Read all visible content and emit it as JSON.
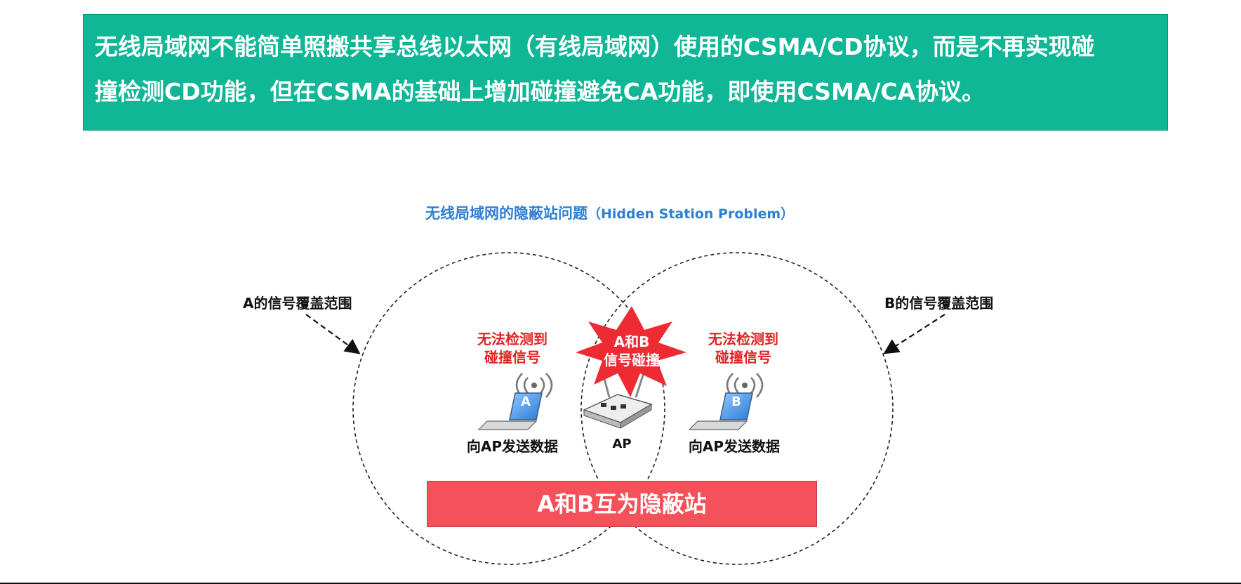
{
  "banner": {
    "line1": "无线局域网不能简单照搬共享总线以太网（有线局域网）使用的CSMA/CD协议，而是不再实现碰",
    "line2": "撞检测CD功能，但在CSMA的基础上增加碰撞避免CA功能，即使用CSMA/CA协议。"
  },
  "diagram": {
    "title_cn": "无线局域网的隐蔽站问题",
    "title_en": "（Hidden Station Problem）",
    "coverage_a": "A的信号覆盖范围",
    "coverage_b": "B的信号覆盖范围",
    "station_a": {
      "badge": "A",
      "warning_line1": "无法检测到",
      "warning_line2": "碰撞信号",
      "caption": "向AP发送数据"
    },
    "station_b": {
      "badge": "B",
      "warning_line1": "无法检测到",
      "warning_line2": "碰撞信号",
      "caption": "向AP发送数据"
    },
    "ap_label": "AP",
    "collision_line1": "A和B",
    "collision_line2": "信号碰撞",
    "conclusion": "A和B互为隐蔽站"
  },
  "colors": {
    "banner_bg": "#10b796",
    "title_blue": "#2f7fd0",
    "warning_red": "#e02424",
    "burst_red": "#ee2b33",
    "conclusion_bar": "#f4515a"
  }
}
